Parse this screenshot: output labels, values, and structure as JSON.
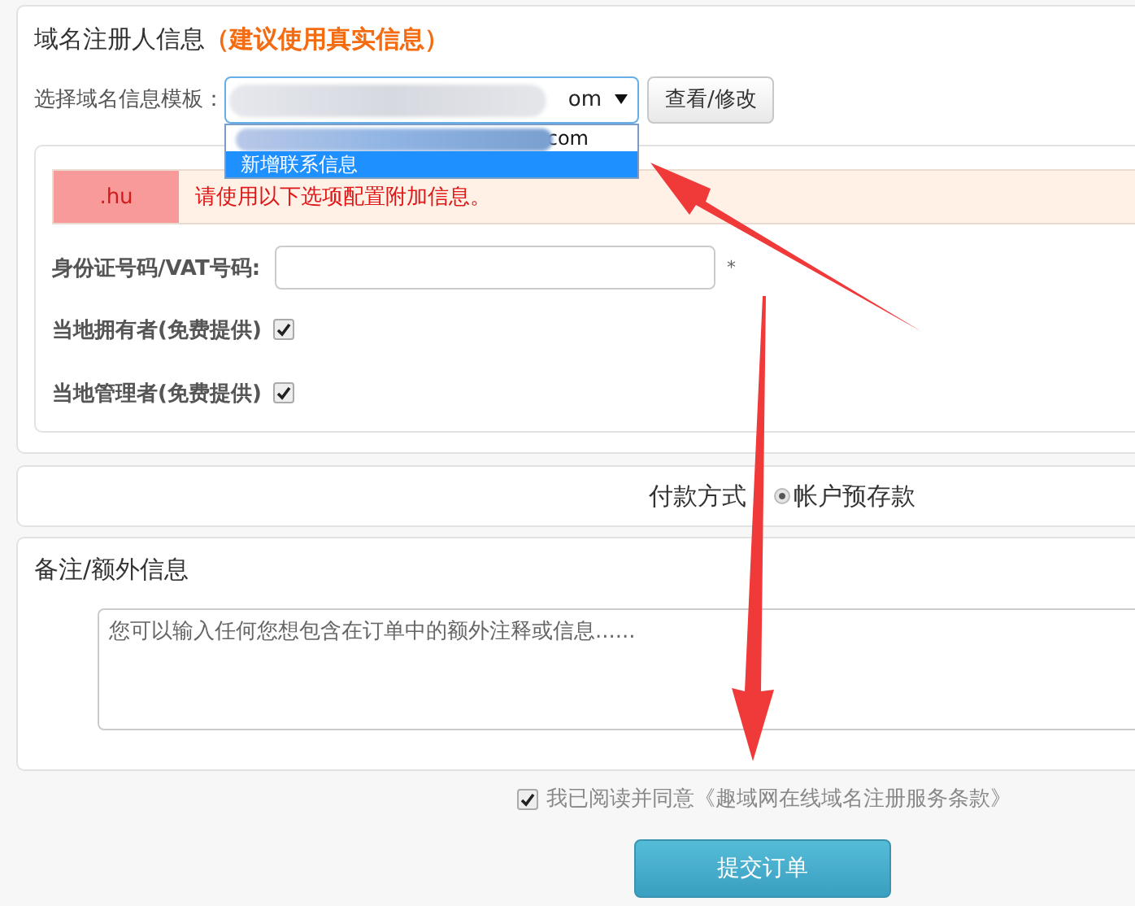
{
  "registrant": {
    "title": "域名注册人信息",
    "hint": "（建议使用真实信息）",
    "template_label": "选择域名信息模板：",
    "template_value": "om",
    "view_button": "查看/修改",
    "dropdown": [
      {
        "label": "com",
        "blurred": true,
        "selected": false
      },
      {
        "label": "新增联系信息",
        "blurred": false,
        "selected": true
      }
    ],
    "extra": {
      "tld": ".hu",
      "notice": "请使用以下选项配置附加信息。",
      "id_label": "身份证号码/VAT号码:",
      "required_mark": "*",
      "options": [
        {
          "label": "当地拥有者(免费提供)",
          "checked": true
        },
        {
          "label": "当地管理者(免费提供)",
          "checked": true
        }
      ]
    }
  },
  "payment": {
    "label": "付款方式",
    "methods": [
      {
        "label": "帐户预存款",
        "selected": true
      }
    ]
  },
  "notes": {
    "title": "备注/额外信息",
    "placeholder": "您可以输入任何您想包含在订单中的额外注释或信息......"
  },
  "agreement": {
    "text": "我已阅读并同意《趣域网在线域名注册服务条款》",
    "checked": true
  },
  "submit": "提交订单"
}
